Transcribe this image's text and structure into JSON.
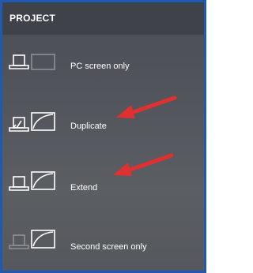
{
  "panel": {
    "title": "PROJECT"
  },
  "options": [
    {
      "label": "PC screen only",
      "icon": "pc-screen-only-icon"
    },
    {
      "label": "Duplicate",
      "icon": "duplicate-icon"
    },
    {
      "label": "Extend",
      "icon": "extend-icon"
    },
    {
      "label": "Second screen only",
      "icon": "second-screen-only-icon"
    }
  ],
  "colors": {
    "border": "#1e5ab4",
    "header": "#3f4349",
    "panel": "#53565c",
    "arrow": "#e03030",
    "dim_icon": "#8e9096"
  }
}
